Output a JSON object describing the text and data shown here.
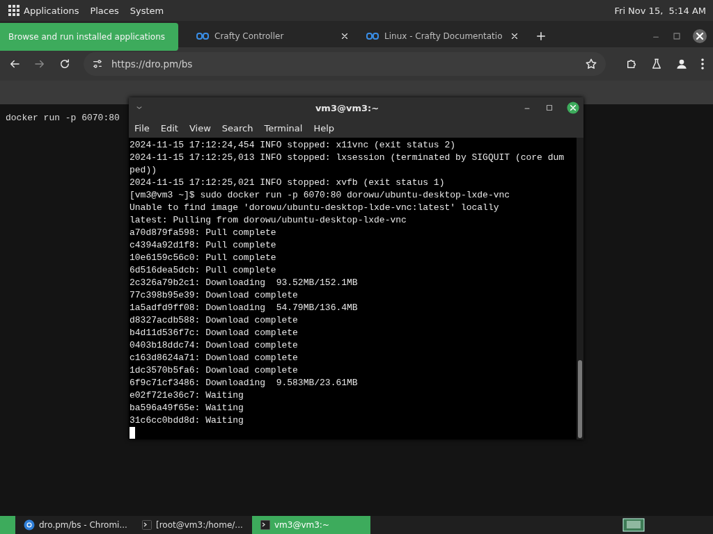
{
  "top_panel": {
    "menus": [
      "Applications",
      "Places",
      "System"
    ],
    "clock": "Fri Nov 15,  5:14 AM"
  },
  "tooltip": "Browse and run installed applications",
  "browser": {
    "tabs": [
      {
        "title": "Crafty Controller",
        "selected": false
      },
      {
        "title": "Linux - Crafty Documentatio",
        "selected": false
      }
    ],
    "url": "https://dro.pm/bs",
    "page_text": "docker run -p 6070:80"
  },
  "terminal": {
    "title": "vm3@vm3:~",
    "menus": [
      "File",
      "Edit",
      "View",
      "Search",
      "Terminal",
      "Help"
    ],
    "lines": [
      "2024-11-15 17:12:24,454 INFO stopped: x11vnc (exit status 2)",
      "2024-11-15 17:12:25,013 INFO stopped: lxsession (terminated by SIGQUIT (core dum",
      "ped))",
      "2024-11-15 17:12:25,021 INFO stopped: xvfb (exit status 1)",
      "[vm3@vm3 ~]$ sudo docker run -p 6070:80 dorowu/ubuntu-desktop-lxde-vnc",
      "Unable to find image 'dorowu/ubuntu-desktop-lxde-vnc:latest' locally",
      "latest: Pulling from dorowu/ubuntu-desktop-lxde-vnc",
      "a70d879fa598: Pull complete",
      "c4394a92d1f8: Pull complete",
      "10e6159c56c0: Pull complete",
      "6d516dea5dcb: Pull complete",
      "2c326a79b2c1: Downloading  93.52MB/152.1MB",
      "77c398b95e39: Download complete",
      "1a5adfd9ff08: Downloading  54.79MB/136.4MB",
      "d8327acdb588: Download complete",
      "b4d11d536f7c: Download complete",
      "0403b18ddc74: Download complete",
      "c163d8624a71: Download complete",
      "1dc3570b5fa6: Download complete",
      "6f9c71cf3486: Downloading  9.583MB/23.61MB",
      "e02f721e36c7: Waiting",
      "ba596a49f65e: Waiting",
      "31c6cc0bdd8d: Waiting"
    ]
  },
  "taskbar": {
    "items": [
      {
        "kind": "browser",
        "label": "dro.pm/bs - Chromi...",
        "selected": false
      },
      {
        "kind": "terminal",
        "label": "[root@vm3:/home/...",
        "selected": false
      },
      {
        "kind": "terminal",
        "label": "vm3@vm3:~",
        "selected": true
      }
    ]
  }
}
